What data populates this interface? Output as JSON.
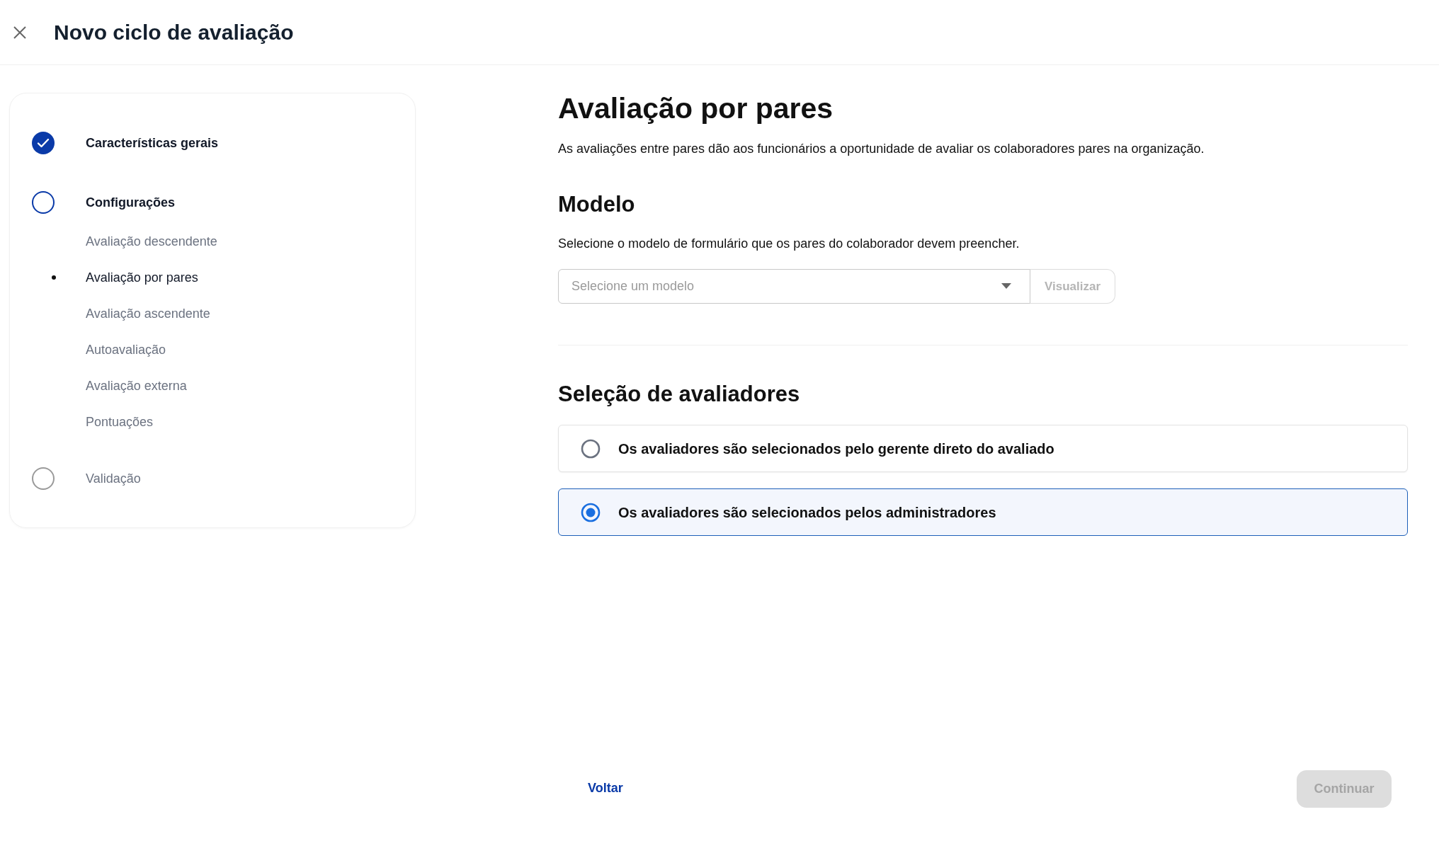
{
  "header": {
    "title": "Novo ciclo de avaliação"
  },
  "steps": [
    {
      "label": "Características gerais",
      "kind": "done"
    },
    {
      "label": "Configurações",
      "kind": "current",
      "substeps": [
        {
          "label": "Avaliação descendente",
          "selected": false
        },
        {
          "label": "Avaliação por pares",
          "selected": true
        },
        {
          "label": "Avaliação ascendente",
          "selected": false
        },
        {
          "label": "Autoavaliação",
          "selected": false
        },
        {
          "label": "Avaliação externa",
          "selected": false
        },
        {
          "label": "Pontuações",
          "selected": false
        }
      ]
    },
    {
      "label": "Validação",
      "kind": "pending"
    }
  ],
  "content": {
    "title": "Avaliação por pares",
    "description": "As avaliações entre pares dão aos funcionários a oportunidade de avaliar os colaboradores pares na organização.",
    "model": {
      "title": "Modelo",
      "description": "Selecione o modelo de formulário que os pares do colaborador devem preencher.",
      "select": {
        "placeholder": "Selecione um modelo"
      },
      "preview_button": {
        "label": "Visualizar",
        "disabled": true
      }
    },
    "evaluators": {
      "title": "Seleção de avaliadores",
      "options": [
        {
          "label": "Os avaliadores são selecionados pelo gerente direto do avaliado",
          "selected": false
        },
        {
          "label": "Os avaliadores são selecionados pelos administradores",
          "selected": true
        }
      ]
    }
  },
  "footer": {
    "back": "Voltar",
    "continue": {
      "label": "Continuar",
      "disabled": true
    }
  }
}
